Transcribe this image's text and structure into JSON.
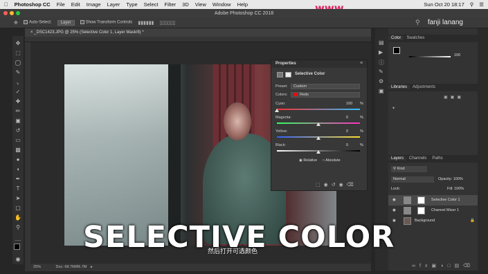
{
  "menubar": {
    "apple": "",
    "app": "Photoshop CC",
    "items": [
      "File",
      "Edit",
      "Image",
      "Layer",
      "Type",
      "Select",
      "Filter",
      "3D",
      "View",
      "Window",
      "Help"
    ],
    "clock": "Sun Oct 20 18:17"
  },
  "window": {
    "title": "Adobe Photoshop CC 2018"
  },
  "watermark": "www.",
  "options": {
    "auto_select_label": "Auto-Select:",
    "auto_select_value": "Layer",
    "transform_label": "Show Transform Controls"
  },
  "user": {
    "name": "fanji lanang"
  },
  "document": {
    "tab": "_DSC1423.JPG @ 25% (Selective Color 1, Layer Mask/8) *",
    "zoom": "25%",
    "doc_info": "Doc: 68.7M/86.7M"
  },
  "properties": {
    "title": "Properties",
    "adjustment": "Selective Color",
    "preset_label": "Preset:",
    "preset_value": "Custom",
    "colors_label": "Colors:",
    "colors_value": "Reds",
    "sliders": [
      {
        "label": "Cyan:",
        "value": "100",
        "unit": "%",
        "level": 1.0
      },
      {
        "label": "Magenta:",
        "value": "0",
        "unit": "%",
        "level": 0.5
      },
      {
        "label": "Yellow:",
        "value": "0",
        "unit": "%",
        "level": 0.5
      },
      {
        "label": "Black:",
        "value": "0",
        "unit": "%",
        "level": 0.5
      }
    ],
    "method_relative": "Relative",
    "method_absolute": "Absolute"
  },
  "color_panel": {
    "tab_color": "Color",
    "tab_swatches": "Swatches",
    "value": "100"
  },
  "libraries_panel": {
    "tab_libraries": "Libraries",
    "tab_adjustments": "Adjustments"
  },
  "layers_panel": {
    "tab_layers": "Layers",
    "tab_channels": "Channels",
    "tab_paths": "Paths",
    "kind": "Kind",
    "blend": "Normal",
    "opacity_label": "Opacity:",
    "opacity_value": "100%",
    "lock_label": "Lock:",
    "fill_label": "Fill:",
    "fill_value": "100%",
    "layers": [
      {
        "name": "Selective Color 1"
      },
      {
        "name": "Channel Mixer 1"
      },
      {
        "name": "Background"
      }
    ]
  },
  "caption": {
    "main": "SELECTIVE COLOR",
    "sub": "然后打开可选颜色"
  }
}
